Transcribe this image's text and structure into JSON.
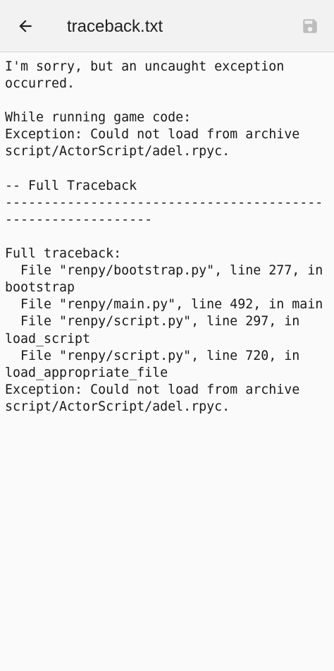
{
  "toolbar": {
    "back_icon": "arrow-back-icon",
    "title": "traceback.txt",
    "save_icon": "save-icon",
    "save_icon_color": "#bdbdbd"
  },
  "document": {
    "text": "I'm sorry, but an uncaught exception\noccurred.\n\nWhile running game code:\nException: Could not load from archive\nscript/ActorScript/adel.rpyc.\n\n-- Full Traceback\n------------------------------------------------------------\n\nFull traceback:\n  File \"renpy/bootstrap.py\", line 277, in\nbootstrap\n  File \"renpy/main.py\", line 492, in main\n  File \"renpy/script.py\", line 297, in\nload_script\n  File \"renpy/script.py\", line 720, in\nload_appropriate_file\nException: Could not load from archive\nscript/ActorScript/adel.rpyc."
  }
}
